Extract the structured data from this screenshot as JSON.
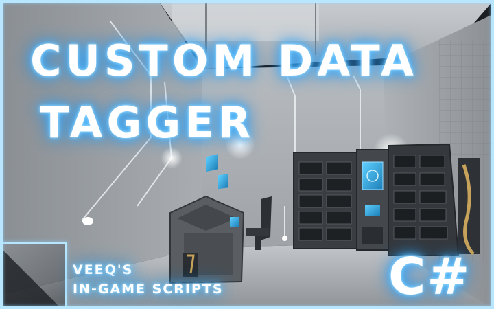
{
  "banner": {
    "title_line_1": "CUSTOM DATA",
    "title_line_2": "TAGGER",
    "subtitle_line_1": "VEEQ'S",
    "subtitle_line_2": "IN-GAME SCRIPTS",
    "language_badge": "C#"
  },
  "colors": {
    "glow": "#63c3ff",
    "frame": "#b8e6ff",
    "wall": "#9ea3a8",
    "floor": "#b5b9bd",
    "rack": "#3a3d41",
    "screen": "#2aa8e0"
  },
  "scene_objects": {
    "left_wall_icon": "wall-panel",
    "terminal_icon": "control-console",
    "chair_icon": "cockpit-chair",
    "rack_icon": "server-rack",
    "kiosk_icon": "screen-kiosk"
  }
}
